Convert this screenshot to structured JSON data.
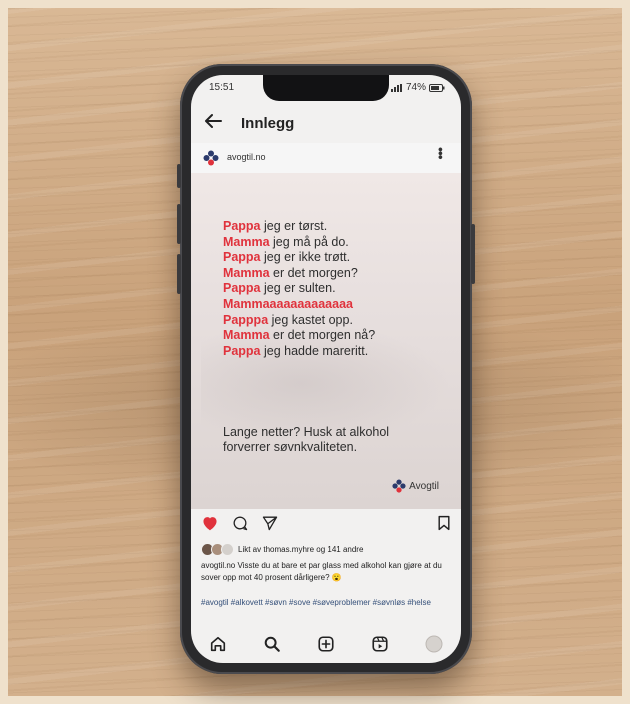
{
  "status_bar": {
    "time": "15:51",
    "battery": "74%"
  },
  "header": {
    "title": "Innlegg",
    "back_icon": "arrow-left-icon"
  },
  "account": {
    "name": "avogtil.no"
  },
  "post": {
    "lines": [
      {
        "name": "Pappa",
        "text": " jeg er tørst."
      },
      {
        "name": "Mamma",
        "text": " jeg må på do."
      },
      {
        "name": "Pappa",
        "text": " jeg er ikke trøtt."
      },
      {
        "name": "Mamma",
        "text": " er det morgen?"
      },
      {
        "name": "Pappa",
        "text": " jeg er sulten."
      },
      {
        "name": "Mammaaaaaaaaaaaaa",
        "text": ""
      },
      {
        "name": "Papppa",
        "text": " jeg kastet opp."
      },
      {
        "name": "Mamma",
        "text": " er det morgen nå?"
      },
      {
        "name": "Pappa",
        "text": " jeg hadde mareritt."
      }
    ],
    "tagline": "Lange netter? Husk at alkohol forverrer søvnkvaliteten.",
    "brand": "Avogtil"
  },
  "likes": {
    "text": "Likt av thomas.myhre og 141 andre"
  },
  "caption": "avogtil.no Visste du at bare et par glass med alkohol kan gjøre at du sover opp mot 40 prosent dårligere? 😮",
  "hashtags": "#avogtil #alkovett #søvn #sove #søveproblemer #søvnløs #helse",
  "colors": {
    "accent_red": "#e0323c",
    "heart": "#e0323c",
    "brand_blue": "#2b3a6b"
  },
  "icons": {
    "actions": [
      "heart-icon",
      "comment-icon",
      "share-icon",
      "bookmark-icon"
    ],
    "nav": [
      "home-icon",
      "search-icon",
      "add-post-icon",
      "reels-icon",
      "profile-icon"
    ]
  }
}
